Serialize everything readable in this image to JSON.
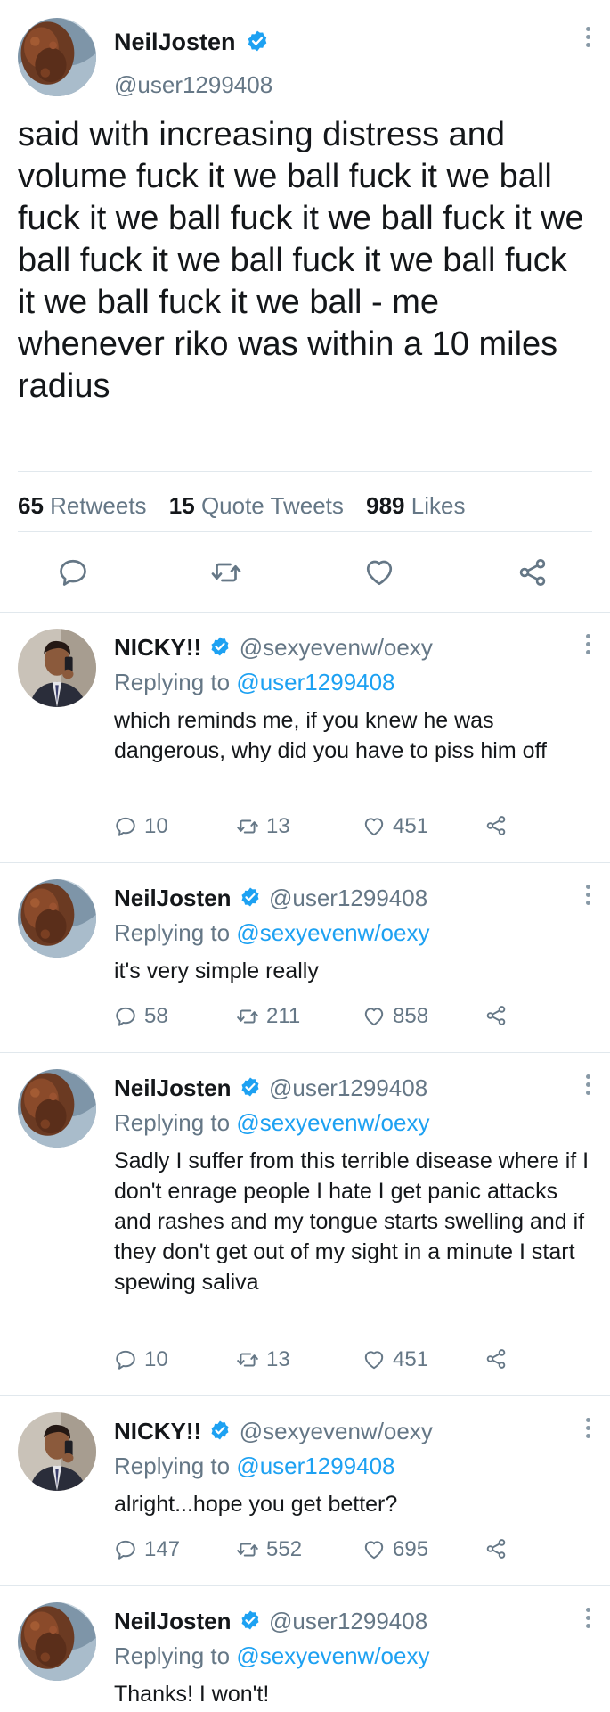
{
  "colors": {
    "link": "#1da1f2",
    "muted": "#657786",
    "text": "#14171a",
    "verified": "#1da1f2"
  },
  "main_tweet": {
    "display_name": "NeilJosten",
    "handle": "@user1299408",
    "text": "said with increasing distress and volume fuck it we ball fuck it we ball fuck it we ball fuck it we ball fuck it we ball fuck it we ball fuck it we ball fuck it we ball fuck it we ball - me whenever riko was within a 10 miles radius",
    "stats": {
      "retweets_count": "65",
      "retweets_label": "Retweets",
      "quotes_count": "15",
      "quotes_label": "Quote Tweets",
      "likes_count": "989",
      "likes_label": "Likes"
    },
    "actions": [
      "reply-icon",
      "retweet-icon",
      "like-icon",
      "share-icon"
    ]
  },
  "replies": [
    {
      "display_name": "NICKY!!",
      "handle": "@sexyevenw/oexy",
      "replying_label": "Replying to",
      "replying_to": "@user1299408",
      "text": "which reminds me, if you knew he was dangerous, why did you have to piss him off",
      "reply_count": "10",
      "retweet_count": "13",
      "like_count": "451"
    },
    {
      "display_name": "NeilJosten",
      "handle": "@user1299408",
      "replying_label": "Replying to",
      "replying_to": "@sexyevenw/oexy",
      "text": "it's very simple really",
      "reply_count": "58",
      "retweet_count": "211",
      "like_count": "858"
    },
    {
      "display_name": "NeilJosten",
      "handle": "@user1299408",
      "replying_label": "Replying to",
      "replying_to": "@sexyevenw/oexy",
      "text": "Sadly I suffer from this terrible disease where if I don't enrage people I hate I get panic attacks and rashes and my tongue starts swelling and if they don't get out of my sight in a minute I start spewing saliva",
      "reply_count": "10",
      "retweet_count": "13",
      "like_count": "451"
    },
    {
      "display_name": "NICKY!!",
      "handle": "@sexyevenw/oexy",
      "replying_label": "Replying to",
      "replying_to": "@user1299408",
      "text": "alright...hope you get better?",
      "reply_count": "147",
      "retweet_count": "552",
      "like_count": "695"
    },
    {
      "display_name": "NeilJosten",
      "handle": "@user1299408",
      "replying_label": "Replying to",
      "replying_to": "@sexyevenw/oexy",
      "text": "Thanks! I won't!"
    }
  ]
}
